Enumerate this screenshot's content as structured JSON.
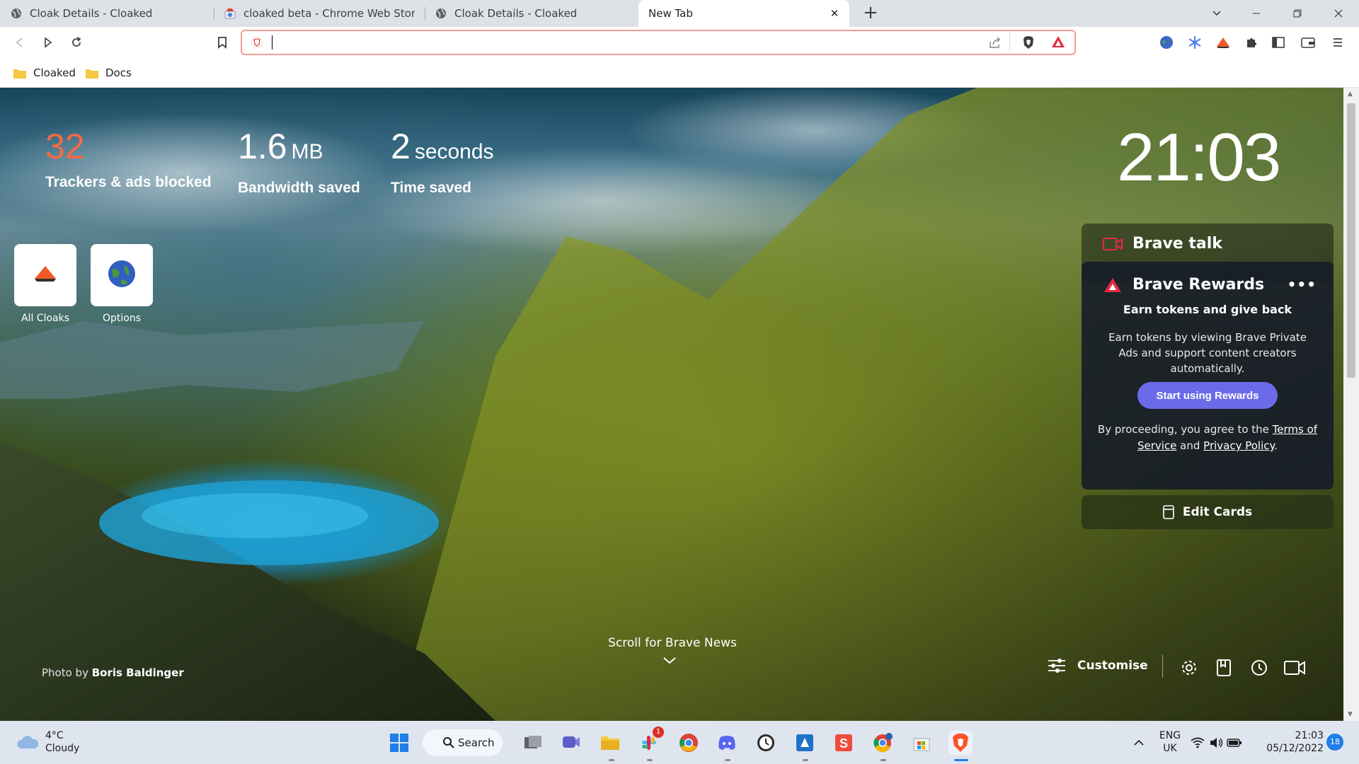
{
  "browser": {
    "tabs": [
      {
        "title": "Cloak Details - Cloaked",
        "active": false
      },
      {
        "title": "cloaked beta - Chrome Web Store",
        "active": false
      },
      {
        "title": "Cloak Details - Cloaked",
        "active": false
      },
      {
        "title": "New Tab",
        "active": true
      }
    ],
    "new_tab_symbol": "+",
    "address_value": "",
    "bookmarks": [
      {
        "label": "Cloaked"
      },
      {
        "label": "Docs"
      }
    ]
  },
  "ntp": {
    "stats": {
      "trackers_value": "32",
      "trackers_label": "Trackers & ads blocked",
      "bandwidth_value": "1.6",
      "bandwidth_unit": "MB",
      "bandwidth_label": "Bandwidth saved",
      "time_value": "2",
      "time_unit": "seconds",
      "time_label": "Time saved"
    },
    "clock": "21:03",
    "top_sites": [
      {
        "label": "All Cloaks"
      },
      {
        "label": "Options"
      }
    ],
    "brave_talk": {
      "title": "Brave talk"
    },
    "rewards": {
      "title": "Brave Rewards",
      "menu": "•••",
      "subtitle": "Earn tokens and give back",
      "body": "Earn tokens by viewing Brave Private Ads and support content creators automatically.",
      "button": "Start using Rewards",
      "terms_prefix": "By proceeding, you agree to the",
      "terms_link": "Terms of Service",
      "terms_and": "and",
      "privacy_link": "Privacy Policy",
      "terms_suffix": "."
    },
    "edit_cards": "Edit Cards",
    "photo_credit_prefix": "Photo by",
    "photo_credit_name": "Boris Baldinger",
    "scroll_news": "Scroll for Brave News",
    "customise": "Customise"
  },
  "taskbar": {
    "weather_temp": "4°C",
    "weather_desc": "Cloudy",
    "search": "Search",
    "lang_top": "ENG",
    "lang_bottom": "UK",
    "time": "21:03",
    "date": "05/12/2022",
    "notification_count": "18",
    "slack_badge": "1"
  },
  "colors": {
    "brave_orange": "#fb542b",
    "rewards_button": "#6b6bea",
    "tracker_count": "#f26a45"
  }
}
